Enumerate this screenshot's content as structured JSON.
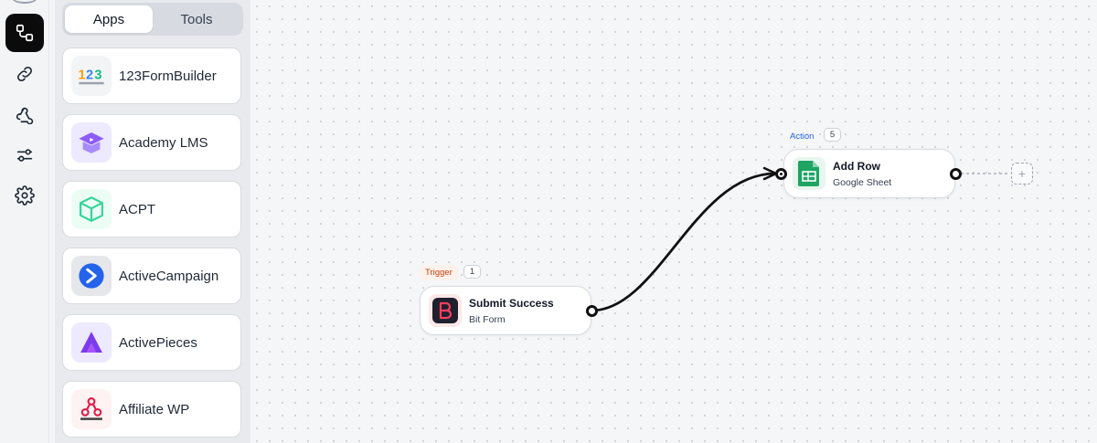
{
  "sidebar_panel": {
    "tabs": [
      {
        "label": "Apps",
        "active": true
      },
      {
        "label": "Tools",
        "active": false
      }
    ],
    "apps": [
      {
        "name": "123FormBuilder",
        "icon": "123formbuilder-logo"
      },
      {
        "name": "Academy LMS",
        "icon": "academy-lms-logo"
      },
      {
        "name": "ACPT",
        "icon": "acpt-logo"
      },
      {
        "name": "ActiveCampaign",
        "icon": "activecampaign-logo"
      },
      {
        "name": "ActivePieces",
        "icon": "activepieces-logo"
      },
      {
        "name": "Affiliate WP",
        "icon": "affiliate-wp-logo"
      }
    ]
  },
  "rail": {
    "items": [
      "flow-icon",
      "link-icon",
      "webhook-icon",
      "settings-sliders-icon",
      "gear-icon"
    ],
    "active": "flow-icon"
  },
  "flow": {
    "trigger": {
      "badge": "Trigger",
      "count": "1",
      "title": "Submit Success",
      "subtitle": "Bit Form",
      "icon": "bit-form-logo"
    },
    "action": {
      "badge": "Action",
      "count": "5",
      "title": "Add Row",
      "subtitle": "Google Sheet",
      "icon": "google-sheets-logo"
    },
    "add_label": "+"
  },
  "colors": {
    "rail_active": "#0b0b0b",
    "trigger_badge": "#c2410c",
    "action_badge": "#2563eb",
    "google_sheets": "#1fa463",
    "bit_form": "#1f1f2e"
  }
}
